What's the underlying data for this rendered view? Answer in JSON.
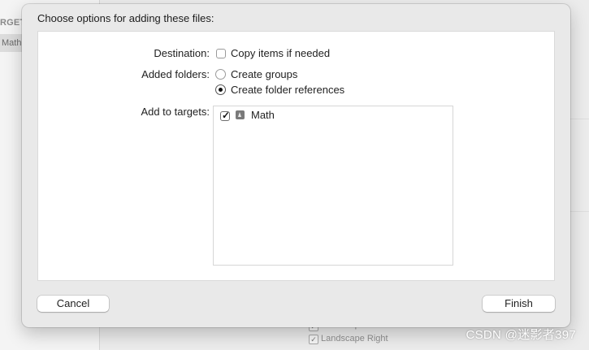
{
  "background": {
    "sidebar_section_label": "RGET",
    "sidebar_item": "Math",
    "orientation_items": [
      {
        "label": "Landscape Left",
        "checked": true
      },
      {
        "label": "Landscape Right",
        "checked": true
      }
    ]
  },
  "dialog": {
    "title": "Choose options for adding these files:",
    "destination": {
      "label": "Destination:",
      "option_label": "Copy items if needed",
      "checked": false
    },
    "added_folders": {
      "label": "Added folders:",
      "options": [
        {
          "label": "Create groups",
          "selected": false
        },
        {
          "label": "Create folder references",
          "selected": true
        }
      ]
    },
    "targets": {
      "label": "Add to targets:",
      "items": [
        {
          "label": "Math",
          "checked": true,
          "icon": "app-target-icon"
        }
      ]
    },
    "cancel_label": "Cancel",
    "finish_label": "Finish"
  },
  "watermark": "CSDN @迷影者397",
  "check_glyph": "✓"
}
